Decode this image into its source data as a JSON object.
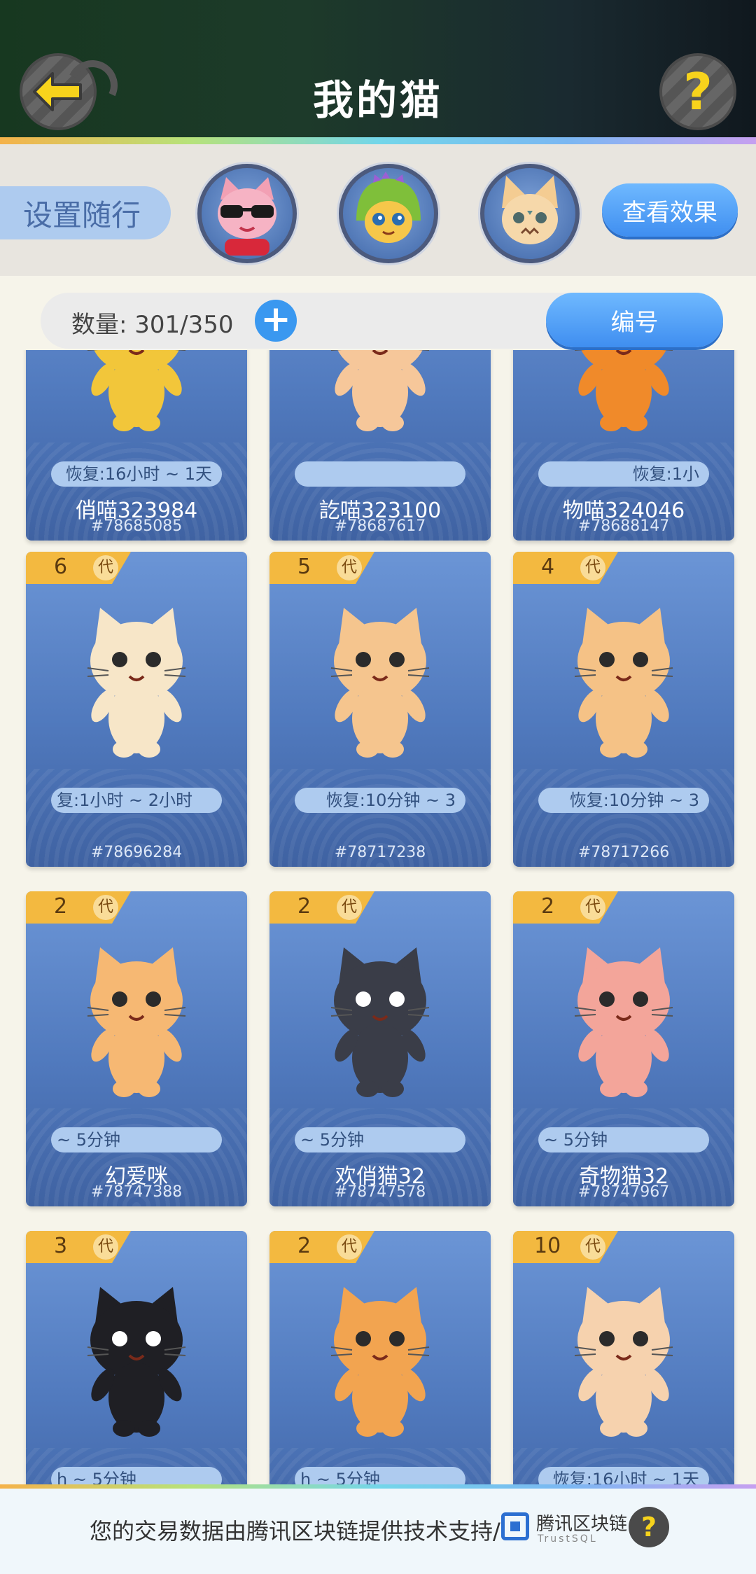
{
  "header": {
    "title": "我的猫",
    "back_icon": "arrow-left-icon",
    "help_glyph": "?"
  },
  "companion": {
    "set_follow_label": "设置随行",
    "view_effect_label": "查看效果",
    "avatars": [
      "pink-cat-sunglasses",
      "green-dino-hood-cat",
      "beige-cat"
    ]
  },
  "count_bar": {
    "count_label": "数量: 301/350",
    "add_glyph": "+",
    "sort_label": "编号"
  },
  "cards": [
    {
      "gen": "",
      "recover": "恢复:16小时 ~ 1天",
      "name": "俏喵323984",
      "id": "#78685085",
      "color": "#f2c63a"
    },
    {
      "gen": "",
      "recover": "",
      "name": "訖喵323100",
      "id": "#78687617",
      "color": "#f6c79a"
    },
    {
      "gen": "",
      "recover": "恢复:1小",
      "name": "物喵324046",
      "id": "#78688147",
      "color": "#f08a2a"
    },
    {
      "gen": "6",
      "recover": "复:1小时 ~ 2小时",
      "name": "",
      "id": "#78696284",
      "color": "#f7e6c8"
    },
    {
      "gen": "5",
      "recover": "恢复:10分钟 ~ 3",
      "name": "",
      "id": "#78717238",
      "color": "#f5c58e"
    },
    {
      "gen": "4",
      "recover": "恢复:10分钟 ~ 3",
      "name": "",
      "id": "#78717266",
      "color": "#f5c286"
    },
    {
      "gen": "2",
      "recover": "~ 5分钟",
      "name": "幻爱咪",
      "id": "#78747388",
      "color": "#f6b873"
    },
    {
      "gen": "2",
      "recover": "~ 5分钟",
      "name": "欢俏猫32",
      "id": "#78747578",
      "color": "#3a3d48"
    },
    {
      "gen": "2",
      "recover": "~ 5分钟",
      "name": "奇物猫32",
      "id": "#78747967",
      "color": "#f3a59a"
    },
    {
      "gen": "3",
      "recover": "h ~ 5分钟",
      "name": "",
      "id": "",
      "color": "#1f1f24"
    },
    {
      "gen": "2",
      "recover": "h ~ 5分钟",
      "name": "",
      "id": "",
      "color": "#f2a450"
    },
    {
      "gen": "10",
      "recover": "恢复:16小时 ~ 1天",
      "name": "",
      "id": "",
      "color": "#f6d2ae"
    }
  ],
  "gen_char": "代",
  "footer": {
    "text": "您的交易数据由腾讯区块链提供技术支持/",
    "brand": "腾讯区块链",
    "brand_sub": "TrustSQL",
    "help_glyph": "?"
  }
}
